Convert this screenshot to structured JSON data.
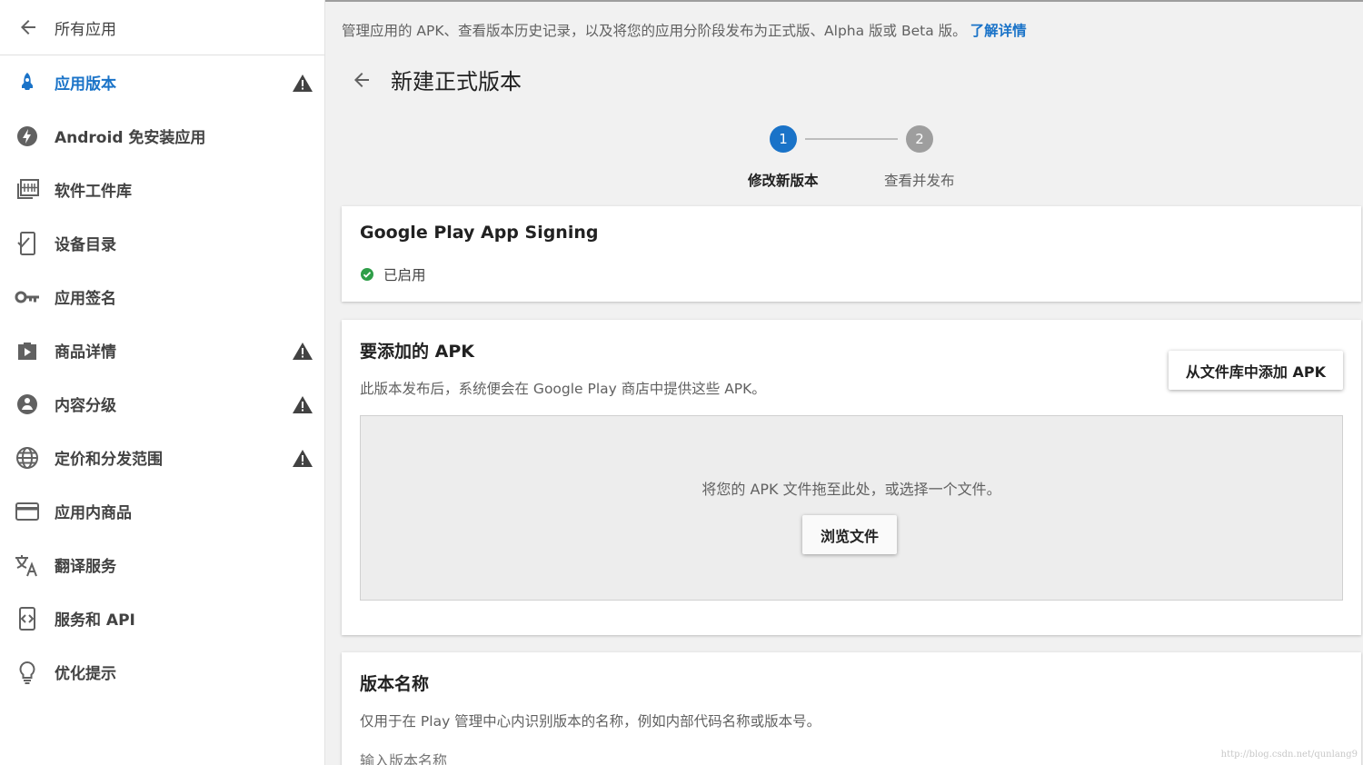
{
  "sidebar": {
    "back_label": "所有应用",
    "items": [
      {
        "label": "应用版本",
        "icon": "rocket-icon",
        "active": true,
        "warning": true
      },
      {
        "label": "Android 免安装应用",
        "icon": "bolt-icon",
        "warning": false
      },
      {
        "label": "软件工件库",
        "icon": "library-icon",
        "warning": false
      },
      {
        "label": "设备目录",
        "icon": "device-catalog-icon",
        "warning": false
      },
      {
        "label": "应用签名",
        "icon": "key-icon",
        "warning": false
      },
      {
        "label": "商品详情",
        "icon": "store-listing-icon",
        "warning": true
      },
      {
        "label": "内容分级",
        "icon": "content-rating-icon",
        "warning": true
      },
      {
        "label": "定价和分发范围",
        "icon": "globe-icon",
        "warning": true
      },
      {
        "label": "应用内商品",
        "icon": "credit-card-icon",
        "warning": false
      },
      {
        "label": "翻译服务",
        "icon": "translate-icon",
        "warning": false
      },
      {
        "label": "服务和 API",
        "icon": "api-icon",
        "warning": false
      },
      {
        "label": "优化提示",
        "icon": "lightbulb-icon",
        "warning": false
      }
    ]
  },
  "main": {
    "intro": "管理应用的 APK、查看版本历史记录，以及将您的应用分阶段发布为正式版、Alpha 版或 Beta 版。",
    "learn_more": "了解详情",
    "title": "新建正式版本",
    "steps": [
      {
        "number": "1",
        "label": "修改新版本",
        "active": true
      },
      {
        "number": "2",
        "label": "查看并发布",
        "active": false
      }
    ],
    "signing": {
      "title": "Google Play App Signing",
      "status": "已启用"
    },
    "apk": {
      "title": "要添加的 APK",
      "description": "此版本发布后，系统便会在 Google Play 商店中提供这些 APK。",
      "add_from_library": "从文件库中添加 APK",
      "drop_hint": "将您的 APK 文件拖至此处，或选择一个文件。",
      "browse": "浏览文件"
    },
    "release_name": {
      "title": "版本名称",
      "description": "仅用于在 Play 管理中心内识别版本的名称，例如内部代码名称或版本号。",
      "placeholder": "输入版本名称"
    }
  },
  "watermark": "http://blog.csdn.net/qunlang9",
  "colors": {
    "accent": "#1a73c8",
    "warning": "#424242",
    "success": "#2e9e48"
  }
}
